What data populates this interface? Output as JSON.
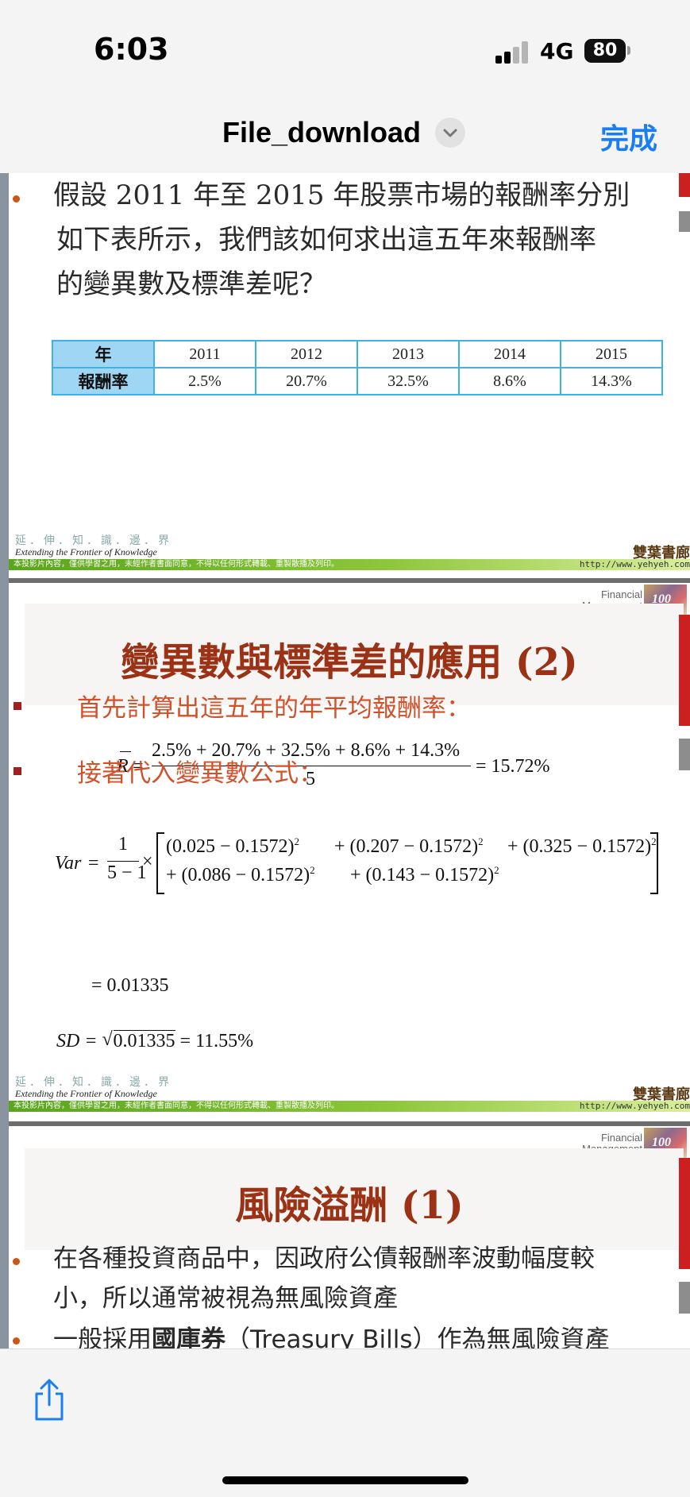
{
  "status_bar": {
    "time": "6:03",
    "network": "4G",
    "battery": "80"
  },
  "nav": {
    "title": "File_download",
    "done": "完成"
  },
  "slide1": {
    "question_lines": [
      "假設 2011 年至 2015 年股票市場的報酬率分別",
      "如下表所示，我們該如何求出這五年來報酬率",
      "的變異數及標準差呢？"
    ],
    "table": {
      "header_label": "年",
      "row_label": "報酬率",
      "years": [
        "2011",
        "2012",
        "2013",
        "2014",
        "2015"
      ],
      "returns": [
        "2.5%",
        "20.7%",
        "32.5%",
        "8.6%",
        "14.3%"
      ]
    }
  },
  "footer": {
    "motto_cn": "延．伸．知．識．邊．界",
    "motto_en": "Extending the Frontier of Knowledge",
    "notice": "本投影片內容，僅供學習之用，未經作者書面同意，不得以任何形式轉載、重製散播及列印。",
    "url": "http://www.yehyeh.com",
    "brand": "雙葉書廊"
  },
  "slide2": {
    "badge": [
      "Financial",
      "Management"
    ],
    "badge_art": "100",
    "title": "變異數與標準差的應用 (2)",
    "step1": "首先計算出這五年的年平均報酬率：",
    "mean": {
      "lhs": "R",
      "numerator": "2.5% + 20.7% + 32.5% + 8.6% + 14.3%",
      "denominator": "5",
      "result": "= 15.72%"
    },
    "step2": "接著代入變異數公式：",
    "var": {
      "lhs": "Var",
      "coef_num": "1",
      "coef_den": "5 − 1",
      "line1": [
        "(0.025 − 0.1572)",
        "+ (0.207 − 0.1572)",
        "+ (0.325 − 0.1572)"
      ],
      "line2": [
        "+ (0.086 − 0.1572)",
        "+ (0.143 − 0.1572)"
      ],
      "exp": "2"
    },
    "var_result": "= 0.01335",
    "sd": {
      "lhs": "SD =",
      "radicand": "0.01335",
      "result": "= 11.55%"
    }
  },
  "slide3": {
    "badge": [
      "Financial",
      "Management"
    ],
    "badge_art": "100",
    "title": "風險溢酬 (1)",
    "bullet1_lines": [
      "在各種投資商品中，因政府公債報酬率波動幅度較",
      "小，所以通常被視為無風險資產"
    ],
    "bullet2": {
      "pre": "一般採用",
      "bold": "國庫券",
      "post": "（Treasury Bills）作為無風險資產"
    }
  }
}
